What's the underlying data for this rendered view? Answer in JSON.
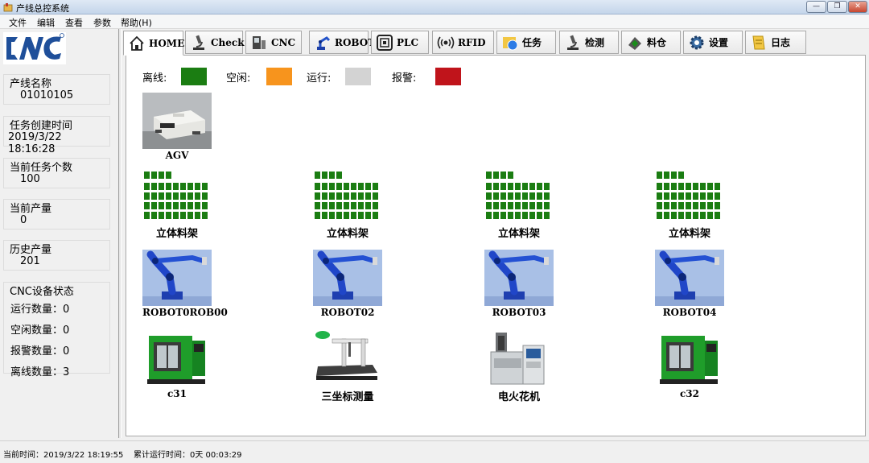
{
  "window": {
    "title": "产线总控系统"
  },
  "menu": [
    "文件",
    "编辑",
    "查看",
    "参数",
    "帮助(H)"
  ],
  "left": {
    "line_name_label": "产线名称",
    "line_name_value": "01010105",
    "created_label": "任务创建时间",
    "created_value": "2019/3/22 18:16:28",
    "task_count_label": "当前任务个数",
    "task_count_value": "100",
    "current_output_label": "当前产量",
    "current_output_value": "0",
    "history_output_label": "历史产量",
    "history_output_value": "201",
    "cnc_status_label": "CNC设备状态",
    "cnc_running": "运行数量：0",
    "cnc_idle": "空闲数量：0",
    "cnc_alarm": "报警数量：0",
    "cnc_offline": "离线数量：3"
  },
  "tabs": [
    {
      "label": "HOME",
      "icon": "home-icon"
    },
    {
      "label": "Check",
      "icon": "microscope-icon"
    },
    {
      "label": "CNC",
      "icon": "cnc-machine-icon"
    },
    {
      "label": "ROBOT",
      "icon": "robot-arm-icon"
    },
    {
      "label": "PLC",
      "icon": "plc-chip-icon"
    },
    {
      "label": "RFID",
      "icon": "rfid-signal-icon"
    },
    {
      "label": "任务",
      "icon": "task-globe-icon"
    },
    {
      "label": "检测",
      "icon": "inspection-icon"
    },
    {
      "label": "料仓",
      "icon": "warehouse-icon"
    },
    {
      "label": "设置",
      "icon": "gear-icon"
    },
    {
      "label": "日志",
      "icon": "log-note-icon"
    }
  ],
  "legend": [
    {
      "label": "离线:",
      "color": "#1b7d12"
    },
    {
      "label": "空闲:",
      "color": "#f7941d"
    },
    {
      "label": "运行:",
      "color": "#d3d3d3"
    },
    {
      "label": "报警:",
      "color": "#c0141b"
    }
  ],
  "devices": {
    "agv": "AGV",
    "racks": [
      "立体料架",
      "立体料架",
      "立体料架",
      "立体料架"
    ],
    "robots": [
      "ROBOT0ROB00",
      "ROBOT02",
      "ROBOT03",
      "ROBOT04"
    ],
    "machines": [
      "c31",
      "三坐标测量",
      "电火花机",
      "c32"
    ]
  },
  "status": {
    "current_time": "当前时间：2019/3/22 18:19:55",
    "run_time": "累计运行时间：0天 00:03:29"
  }
}
